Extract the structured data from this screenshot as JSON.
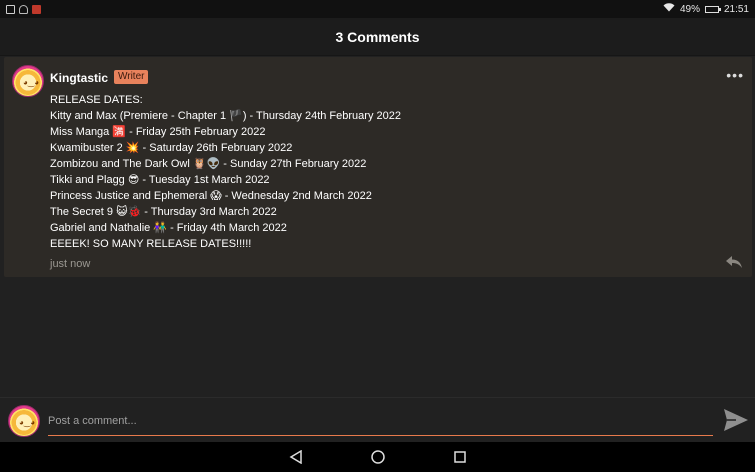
{
  "statusbar": {
    "battery": "49%",
    "time": "21:51",
    "battery_level": 0.49
  },
  "header": {
    "title": "3 Comments"
  },
  "comment": {
    "author": "Kingtastic",
    "badge": "Writer",
    "more_icon": "more-dots-icon",
    "lines": [
      "RELEASE DATES:",
      "Kitty and Max (Premiere - Chapter 1 🏴) - Thursday 24th February 2022",
      "Miss Manga 🈵 - Friday 25th February 2022",
      "Kwamibuster 2 💥 - Saturday 26th February 2022",
      "Zombizou and The Dark Owl 🦉👽 - Sunday 27th February 2022",
      "Tikki and Plagg 😎 - Tuesday 1st March 2022",
      "Princess Justice and Ephemeral 😱 - Wednesday 2nd March 2022",
      "The Secret 9 😺🐞 - Thursday 3rd March 2022",
      "Gabriel and Nathalie 👫 - Friday 4th March 2022",
      "EEEEK! SO MANY RELEASE DATES!!!!!"
    ],
    "time": "just now",
    "reply_icon": "reply-icon"
  },
  "composer": {
    "placeholder": "Post a comment...",
    "send_icon": "send-icon"
  },
  "navbar": {
    "back_icon": "back-triangle-icon",
    "home_icon": "home-circle-icon",
    "recents_icon": "recents-square-icon"
  }
}
